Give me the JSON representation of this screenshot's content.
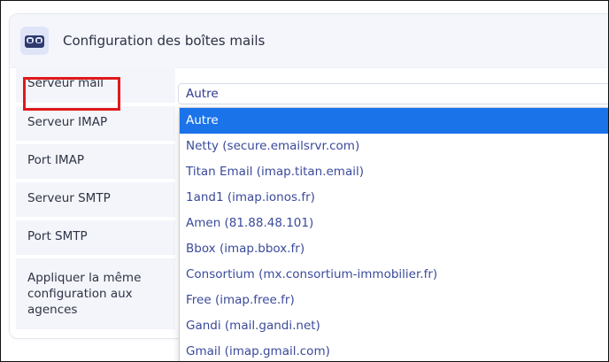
{
  "header": {
    "title": "Configuration des boîtes mails",
    "icon": "mailbox-icon"
  },
  "labels": [
    {
      "id": "mail-server",
      "text": "Serveur mail"
    },
    {
      "id": "imap-server",
      "text": "Serveur IMAP"
    },
    {
      "id": "imap-port",
      "text": "Port IMAP"
    },
    {
      "id": "smtp-server",
      "text": "Serveur SMTP"
    },
    {
      "id": "smtp-port",
      "text": "Port SMTP"
    },
    {
      "id": "apply-agencies",
      "text": "Appliquer la même configuration aux agences"
    }
  ],
  "mail_server_select": {
    "value": "Autre"
  },
  "dropdown": {
    "options": [
      "Autre",
      "Netty (secure.emailsrvr.com)",
      "Titan Email (imap.titan.email)",
      "1and1 (imap.ionos.fr)",
      "Amen (81.88.48.101)",
      "Bbox (imap.bbox.fr)",
      "Consortium (mx.consortium-immobilier.fr)",
      "Free (imap.free.fr)",
      "Gandi (mail.gandi.net)",
      "Gmail (imap.gmail.com)"
    ],
    "selected_index": 0
  },
  "colors": {
    "selected_bg": "#1a73e8",
    "option_text": "#3a4a9a",
    "highlight": "#e0191b",
    "label_bg": "#f3f5fa"
  }
}
